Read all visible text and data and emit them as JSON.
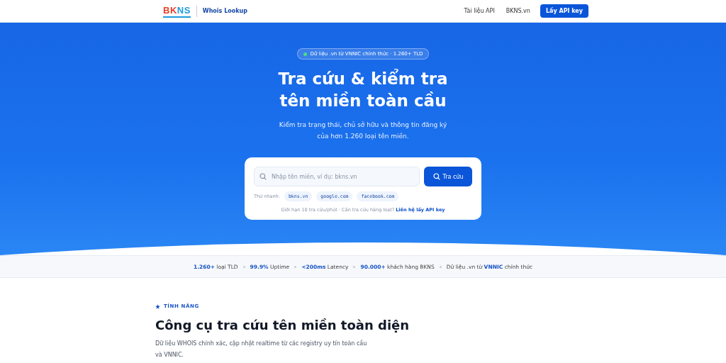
{
  "header": {
    "logo": [
      {
        "text": "BK",
        "color": "#e8402c"
      },
      {
        "text": "NS",
        "color": "#1e9be0"
      }
    ],
    "product": "Whois Lookup",
    "nav": [
      "Tài liệu API",
      "BKNS.vn"
    ],
    "cta": "Lấy API key"
  },
  "hero": {
    "badge": "Dữ liệu .vn từ VNNIC chính thức · 1.260+ TLD",
    "title_lines": [
      "Tra cứu & kiểm tra",
      "tên miền toàn cầu"
    ],
    "subtitle_lines": [
      "Kiểm tra trạng thái, chủ sở hữu và thông tin đăng ký",
      "của hơn 1.260 loại tên miền."
    ]
  },
  "search": {
    "placeholder": "Nhập tên miền, ví dụ: bkns.vn",
    "button": "Tra cứu",
    "quick_label": "Thử nhanh:",
    "quick": [
      "bkns.vn",
      "google.com",
      "facebook.com"
    ],
    "hint": "Giới hạn 10 tra cứu/phút · Cần tra cứu hàng loạt?",
    "hint_link": "Liên hệ lấy API key"
  },
  "stats": [
    {
      "value": "1.260+",
      "label": "loại TLD"
    },
    {
      "value": "99.9%",
      "label": "Uptime"
    },
    {
      "value": "<200ms",
      "label": "Latency"
    },
    {
      "value": "90.000+",
      "label": "khách hàng BKNS"
    },
    {
      "text": "Dữ liệu .vn từ **VNNIC** chính thức"
    }
  ],
  "features": {
    "eyebrow": "TÍNH NĂNG",
    "title": "Công cụ tra cứu tên miền toàn diện",
    "description": "Dữ liệu WHOIS chính xác, cập nhật realtime từ các registry uy tín toàn cầu và VNNIC."
  }
}
